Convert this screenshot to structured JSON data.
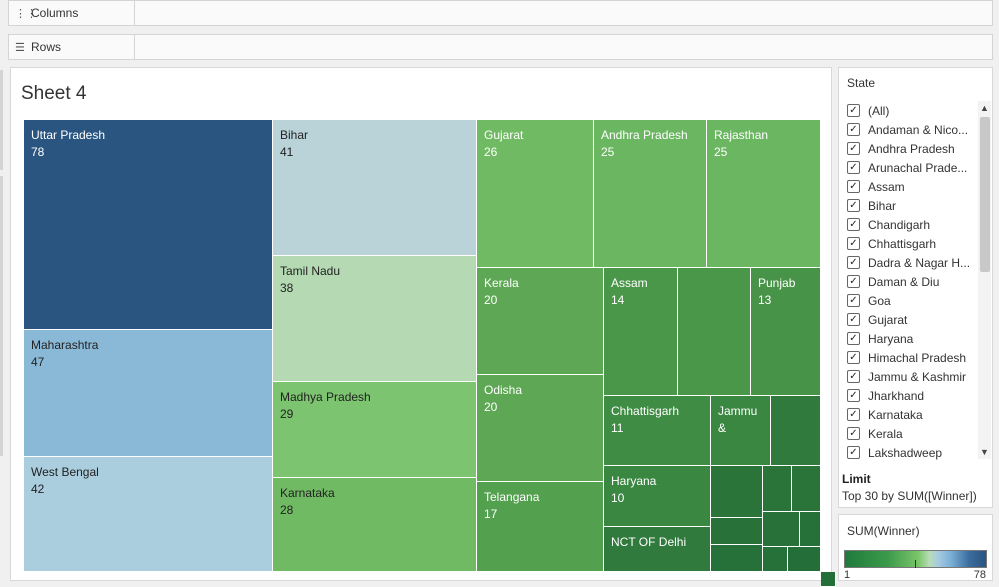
{
  "shelves": {
    "columns_label": "Columns",
    "rows_label": "Rows",
    "columns_icon": "columns-icon",
    "rows_icon": "rows-icon"
  },
  "sheet": {
    "title": "Sheet 4"
  },
  "treemap": {
    "measure": "SUM(Winner)",
    "cells": [
      {
        "name": "Uttar Pradesh",
        "value": "78",
        "color": "#2a5580"
      },
      {
        "name": "Maharashtra",
        "value": "47",
        "color": "#8ab9d8"
      },
      {
        "name": "West Bengal",
        "value": "42",
        "color": "#abcedf"
      },
      {
        "name": "Bihar",
        "value": "41",
        "color": "#b9d3d9"
      },
      {
        "name": "Tamil Nadu",
        "value": "38",
        "color": "#b5dab3"
      },
      {
        "name": "Madhya Pradesh",
        "value": "29",
        "color": "#7cc46f"
      },
      {
        "name": "Karnataka",
        "value": "28",
        "color": "#71ba64"
      },
      {
        "name": "Gujarat",
        "value": "26",
        "color": "#71ba64"
      },
      {
        "name": "Andhra Pradesh",
        "value": "25",
        "color": "#6bb661"
      },
      {
        "name": "Rajasthan",
        "value": "25",
        "color": "#6bb661"
      },
      {
        "name": "Kerala",
        "value": "20",
        "color": "#5ea755"
      },
      {
        "name": "Odisha",
        "value": "20",
        "color": "#5ea755"
      },
      {
        "name": "Telangana",
        "value": "17",
        "color": "#53a04f"
      },
      {
        "name": "Assam",
        "value": "14",
        "color": "#4a974a"
      },
      {
        "name": "",
        "value": "",
        "color": "#4a974a"
      },
      {
        "name": "Punjab",
        "value": "13",
        "color": "#479448"
      },
      {
        "name": "Chhattisgarh",
        "value": "11",
        "color": "#3f8c44"
      },
      {
        "name": "Jammu",
        "value": "&",
        "color": "#3a8742"
      },
      {
        "name": "",
        "value": "",
        "color": "#2f7a3c"
      },
      {
        "name": "Haryana",
        "value": "10",
        "color": "#3a8742"
      },
      {
        "name": "NCT OF Delhi",
        "value": "",
        "color": "#2f7a3c"
      },
      {
        "name": "",
        "value": "",
        "color": "#2a743a"
      },
      {
        "name": "",
        "value": "",
        "color": "#2a743a"
      },
      {
        "name": "",
        "value": "",
        "color": "#2a743a"
      },
      {
        "name": "",
        "value": "",
        "color": "#28723a"
      },
      {
        "name": "",
        "value": "",
        "color": "#28723a"
      },
      {
        "name": "",
        "value": "",
        "color": "#26703a"
      },
      {
        "name": "",
        "value": "",
        "color": "#26703a"
      },
      {
        "name": "",
        "value": "",
        "color": "#26703a"
      },
      {
        "name": "",
        "value": "",
        "color": "#246e39"
      },
      {
        "name": "",
        "value": "",
        "color": "#246e39"
      }
    ]
  },
  "filter": {
    "title": "State",
    "items": [
      "(All)",
      "Andaman & Nico...",
      "Andhra Pradesh",
      "Arunachal Prade...",
      "Assam",
      "Bihar",
      "Chandigarh",
      "Chhattisgarh",
      "Dadra & Nagar H...",
      "Daman & Diu",
      "Goa",
      "Gujarat",
      "Haryana",
      "Himachal Pradesh",
      "Jammu & Kashmir",
      "Jharkhand",
      "Karnataka",
      "Kerala",
      "Lakshadweep"
    ],
    "check_glyph": "✓",
    "limit_title": "Limit",
    "limit_text": "Top 30 by SUM([Winner])"
  },
  "legend": {
    "title": "SUM(Winner)",
    "min": "1",
    "max": "78"
  }
}
